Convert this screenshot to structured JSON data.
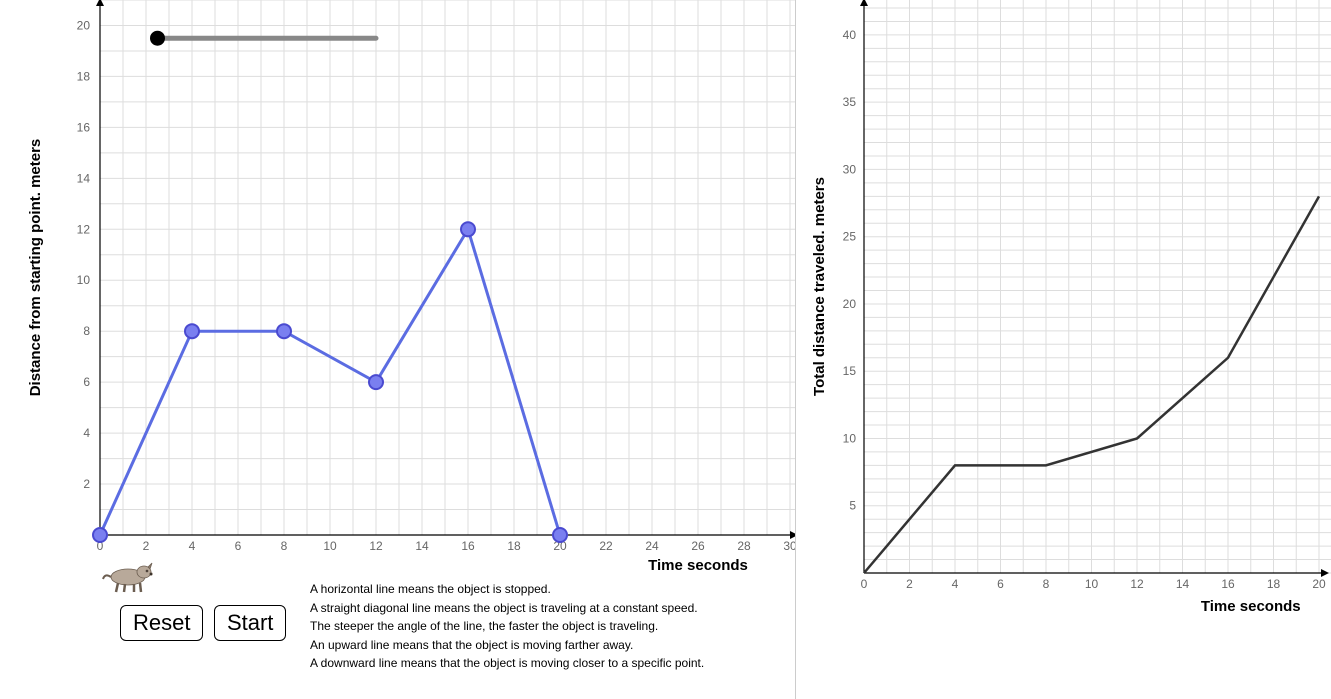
{
  "left_chart": {
    "y_axis_label": "Distance from starting point.   meters",
    "x_axis_label": "Time seconds",
    "x_ticks": [
      0,
      2,
      4,
      6,
      8,
      10,
      12,
      14,
      16,
      18,
      20,
      22,
      24,
      26,
      28,
      30
    ],
    "y_ticks": [
      2,
      4,
      6,
      8,
      10,
      12,
      14,
      16,
      18,
      20
    ]
  },
  "slider": {
    "min": 0,
    "max": 20,
    "value": 0
  },
  "buttons": {
    "reset": "Reset",
    "start": "Start"
  },
  "info_lines": [
    "A horizontal line means the object is stopped.",
    "A straight diagonal line means the object is traveling at a constant speed.",
    "The steeper the angle of the line, the faster the object is traveling.",
    "An upward line means that the object is moving farther away.",
    " A downward line means that the object is moving closer to a specific point."
  ],
  "right_chart": {
    "y_axis_label": "Total distance traveled.   meters",
    "x_axis_label": "Time seconds",
    "x_ticks": [
      0,
      2,
      4,
      6,
      8,
      10,
      12,
      14,
      16,
      18,
      20
    ],
    "y_ticks": [
      5,
      10,
      15,
      20,
      25,
      30,
      35,
      40
    ]
  },
  "chart_data": [
    {
      "type": "line",
      "title": "",
      "xlabel": "Time seconds",
      "ylabel": "Distance from starting point.   meters",
      "xlim": [
        0,
        30
      ],
      "ylim": [
        0,
        21
      ],
      "series": [
        {
          "name": "distance_from_start",
          "x": [
            0,
            4,
            8,
            12,
            16,
            20
          ],
          "values": [
            0,
            8,
            8,
            6,
            12,
            0
          ]
        }
      ]
    },
    {
      "type": "line",
      "title": "",
      "xlabel": "Time seconds",
      "ylabel": "Total distance traveled.   meters",
      "xlim": [
        0,
        20
      ],
      "ylim": [
        0,
        42
      ],
      "series": [
        {
          "name": "total_distance",
          "x": [
            0,
            4,
            8,
            12,
            16,
            20
          ],
          "values": [
            0,
            8,
            8,
            10,
            16,
            28
          ]
        }
      ]
    }
  ]
}
